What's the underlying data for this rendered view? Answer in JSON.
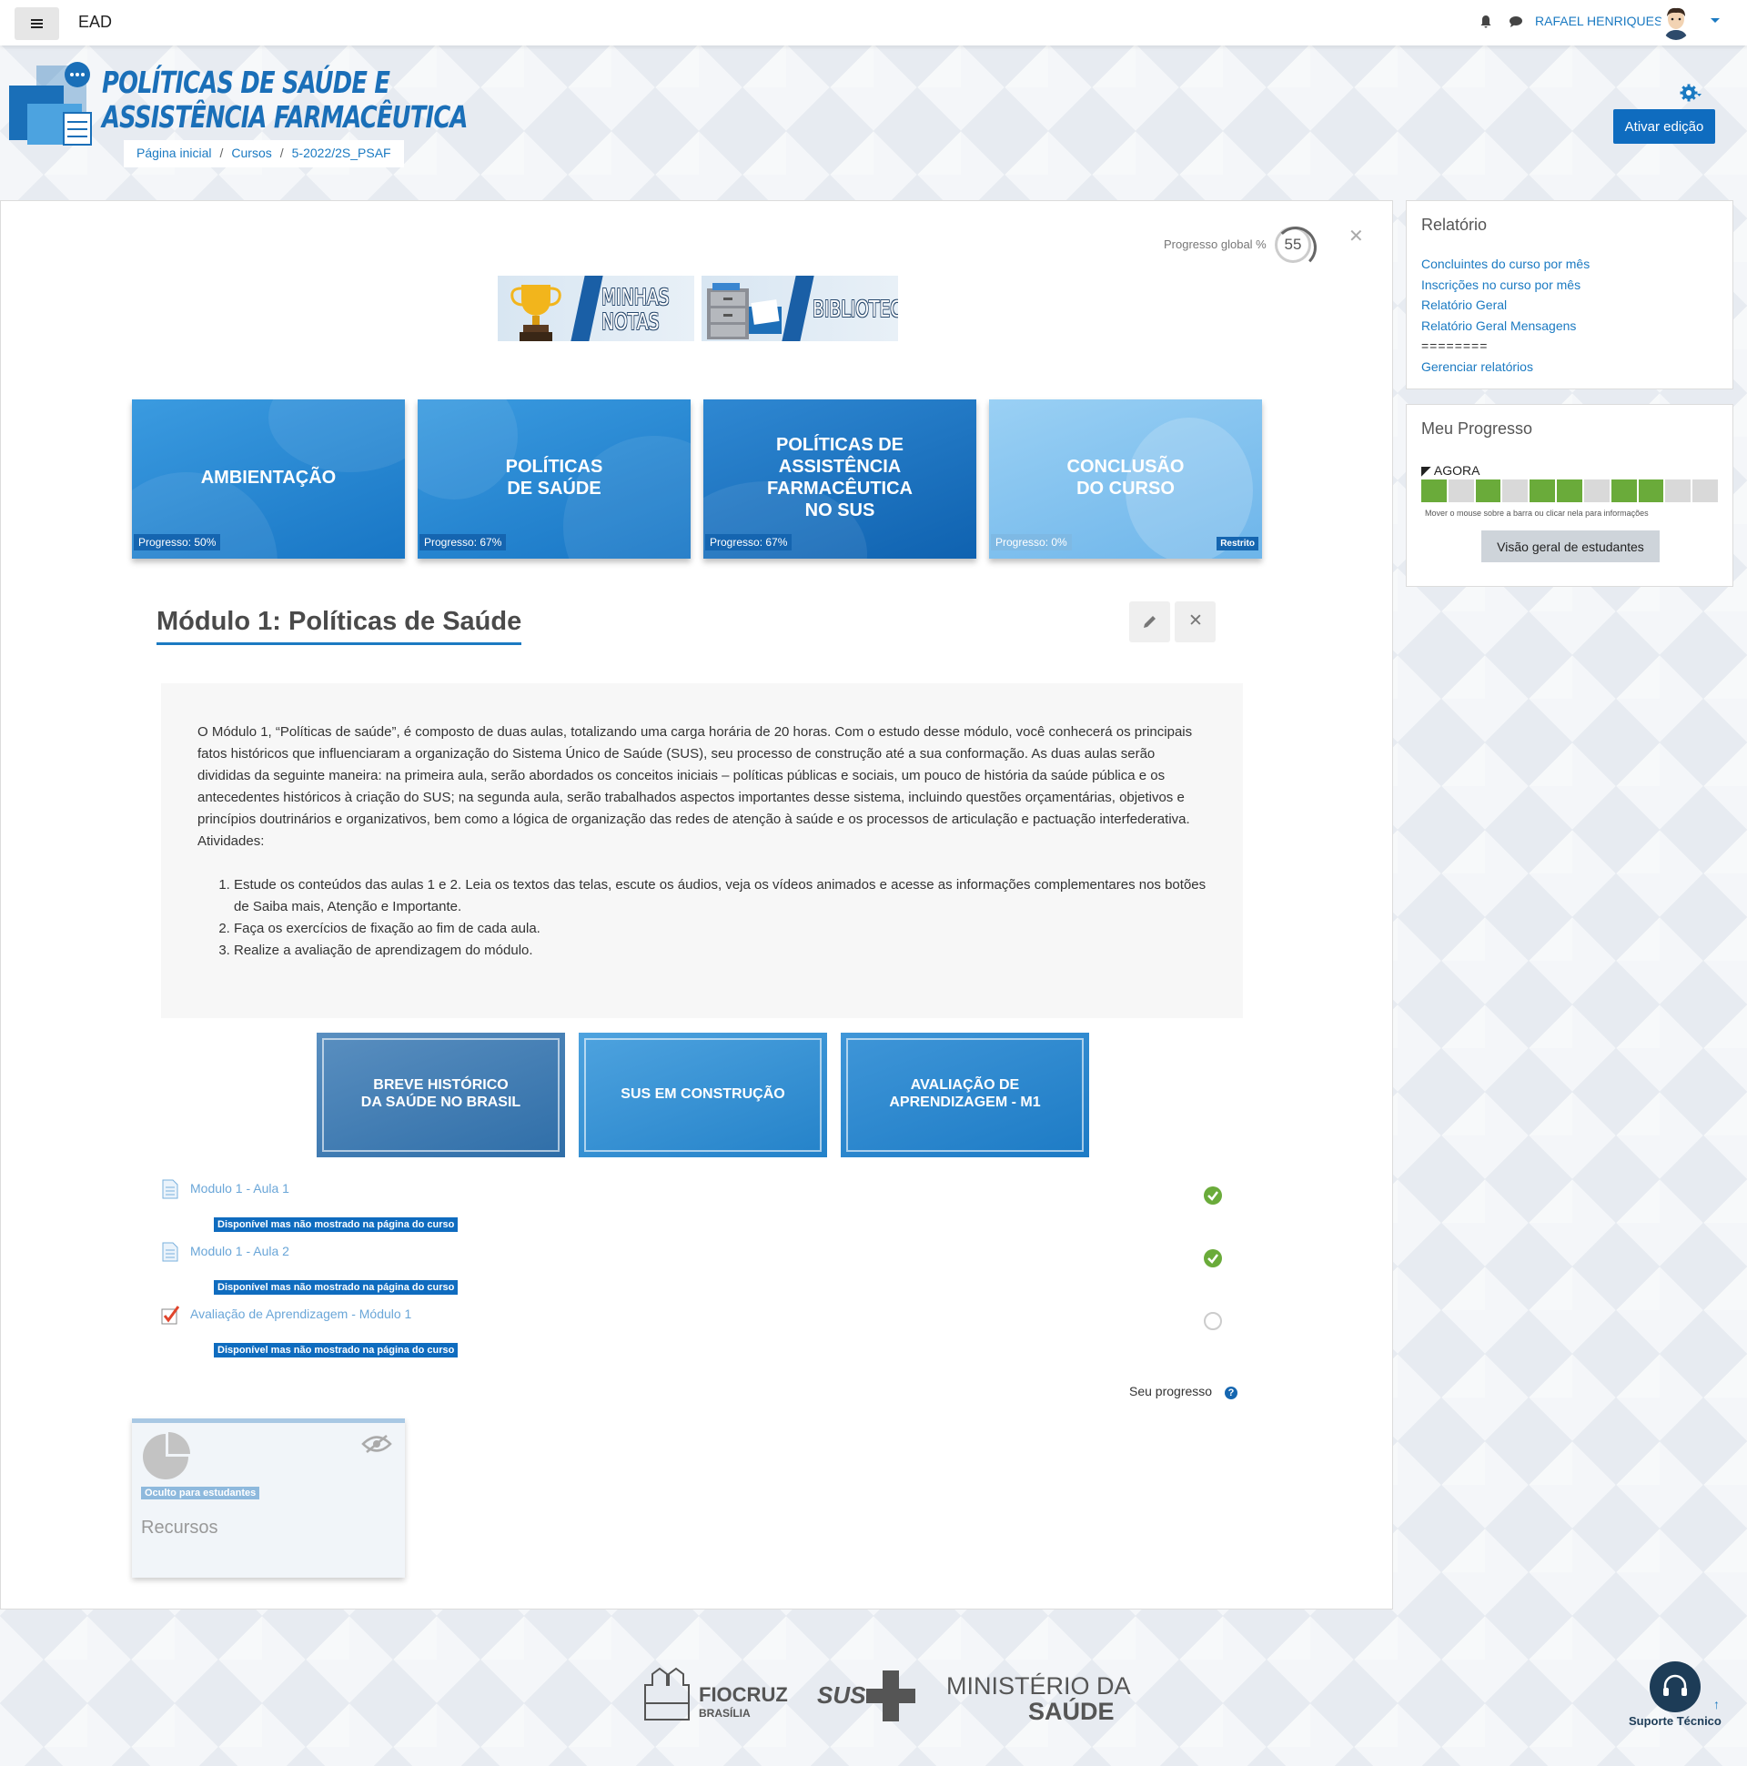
{
  "navbar": {
    "brand": "EAD",
    "user_name": "RAFAEL HENRIQUES"
  },
  "header": {
    "course_title_line1": "POLÍTICAS DE SAÚDE E",
    "course_title_line2": "ASSISTÊNCIA FARMACÊUTICA",
    "breadcrumb": [
      "Página inicial",
      "Cursos",
      "5-2022/2S_PSAF"
    ],
    "edit_button": "Ativar edição"
  },
  "main": {
    "global_progress_label": "Progresso global %",
    "global_progress_value": "55",
    "banners": [
      {
        "label_line1": "MINHAS",
        "label_line2": "NOTAS"
      },
      {
        "label_line1": "BIBLIOTECA"
      }
    ],
    "tiles": [
      {
        "title_line1": "AMBIENTAÇÃO",
        "progress": "Progresso: 50%"
      },
      {
        "title_line1": "POLÍTICAS",
        "title_line2": "DE SAÚDE",
        "progress": "Progresso: 67%"
      },
      {
        "title_line1": "POLÍTICAS DE",
        "title_line2": "ASSISTÊNCIA",
        "title_line3": "FARMACÊUTICA",
        "title_line4": "NO SUS",
        "progress": "Progresso: 67%"
      },
      {
        "title_line1": "CONCLUSÃO",
        "title_line2": "DO CURSO",
        "progress": "Progresso: 0%",
        "restricted": "Restrito"
      }
    ],
    "module_title": "Módulo 1: Políticas de Saúde",
    "summary_paragraph": "O Módulo 1, “Políticas de saúde”, é composto de duas aulas, totalizando uma carga horária de 20 horas. Com o estudo desse módulo, você conhecerá os principais fatos históricos que influenciaram a organização do Sistema Único de Saúde (SUS), seu processo de construção até a sua conformação. As duas aulas serão divididas da seguinte maneira: na primeira aula, serão abordados os conceitos iniciais – políticas públicas e sociais, um pouco de história da saúde pública e os antecedentes históricos à criação do SUS; na segunda aula, serão trabalhados aspectos importantes desse sistema, incluindo questões orçamentárias, objetivos e princípios doutrinários e organizativos, bem como a lógica de organização das redes de atenção à saúde e os processos de articulação e pactuação interfederativa. Atividades:",
    "summary_items": [
      "Estude os conteúdos das aulas 1 e 2. Leia os textos das telas, escute os áudios, veja os vídeos animados e acesse as informações complementares nos botões de Saiba mais, Atenção e Importante.",
      "Faça os exercícios de fixação ao fim de cada aula.",
      "Realize a avaliação de aprendizagem do módulo."
    ],
    "lesson_tiles": [
      {
        "line1": "BREVE HISTÓRICO",
        "line2": "DA SAÚDE NO BRASIL"
      },
      {
        "line1": "SUS EM CONSTRUÇÃO"
      },
      {
        "line1": "AVALIAÇÃO DE",
        "line2": "APRENDIZAGEM - M1"
      }
    ],
    "activities": [
      {
        "name": "Modulo 1 - Aula 1",
        "badge": "Disponível mas não mostrado na página do curso",
        "completed": true
      },
      {
        "name": "Modulo 1 - Aula 2",
        "badge": "Disponível mas não mostrado na página do curso",
        "completed": true
      },
      {
        "name": "Avaliação de Aprendizagem - Módulo 1",
        "badge": "Disponível mas não mostrado na página do curso",
        "completed": false
      }
    ],
    "seu_progresso": "Seu progresso",
    "resource_card": {
      "badge": "Oculto para estudantes",
      "title": "Recursos"
    }
  },
  "sidebar": {
    "relatorio": {
      "title": "Relatório",
      "links": [
        "Concluintes do curso por mês",
        "Inscrições no curso por mês",
        "Relatório Geral",
        "Relatório Geral Mensagens"
      ],
      "separator": "========",
      "manage_link": "Gerenciar relatórios"
    },
    "progresso": {
      "title": "Meu Progresso",
      "now_label": "AGORA",
      "segments": [
        true,
        false,
        true,
        false,
        true,
        true,
        false,
        true,
        true,
        false,
        false
      ],
      "hint": "Mover o mouse sobre a barra ou clicar nela para informações",
      "overview_button": "Visão geral de estudantes"
    }
  },
  "footer": {
    "fiocruz": "FIOCRUZ",
    "fiocruz_sub": "BRASÍLIA",
    "sus": "SUS",
    "ministerio_line1": "MINISTÉRIO DA",
    "ministerio_line2": "SAÚDE",
    "support_label": "Suporte Técnico"
  },
  "colors": {
    "primary": "#0f6cbf",
    "link": "#1b7ac2",
    "progress_done": "#6aab3a",
    "progress_todo": "#d9d9d9",
    "check_done": "#6aab3a"
  }
}
